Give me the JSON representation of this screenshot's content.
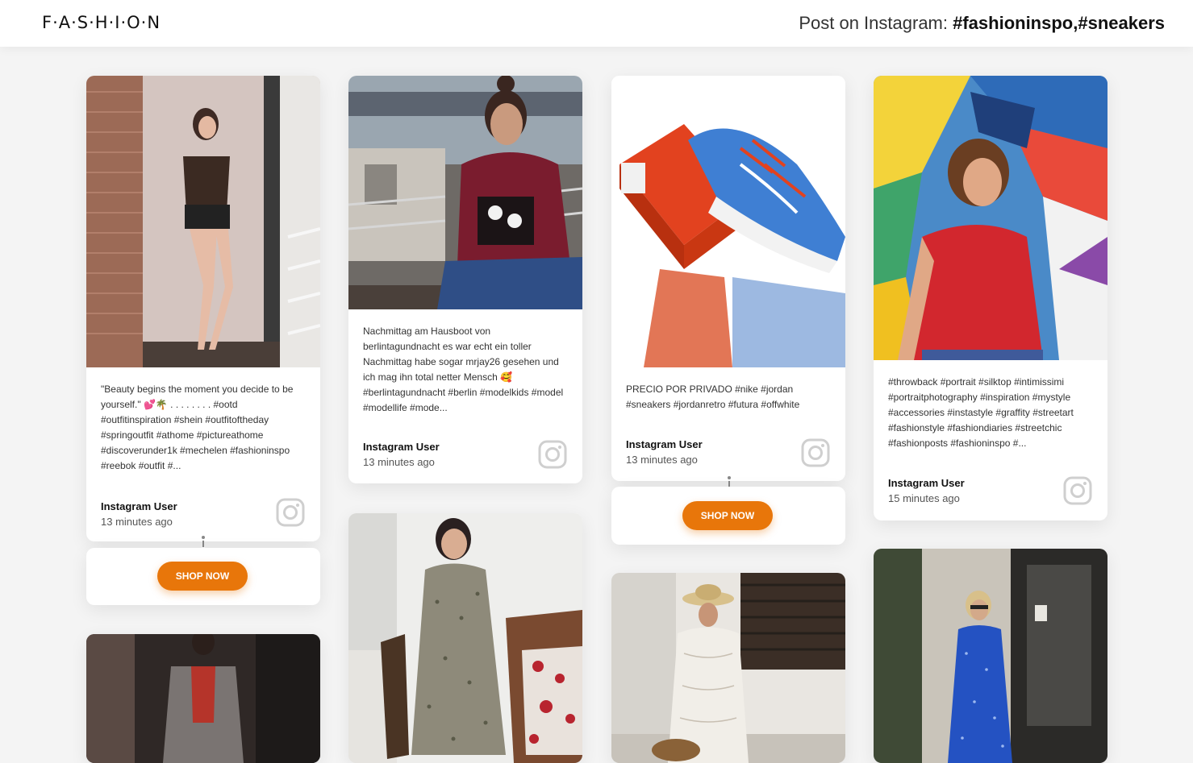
{
  "header": {
    "logo": "F·A·S·H·I·O·N",
    "prefix": "Post on Instagram: ",
    "tags": "#fashioninspo,#sneakers"
  },
  "posts": [
    {
      "caption": "\"Beauty begins the moment you decide to be yourself.\" 💕🌴 . . . . . . . . #ootd #outfitinspiration #shein #outfitoftheday #springoutfit #athome #pictureathome #discoverunder1k #mechelen #fashioninspo #reebok #outfit #...",
      "user": "Instagram User",
      "time": "13 minutes ago",
      "shop_label": "SHOP NOW"
    },
    {
      "caption": "Nachmittag am Hausboot von berlintagundnacht es war echt ein toller Nachmittag habe sogar mrjay26 gesehen und ich mag ihn total netter Mensch 🥰 #berlintagundnacht #berlin #modelkids #model #modellife #mode...",
      "user": "Instagram User",
      "time": "13 minutes ago"
    },
    {
      "caption": "PRECIO POR PRIVADO #nike #jordan #sneakers #jordanretro #futura #offwhite",
      "user": "Instagram User",
      "time": "13 minutes ago",
      "shop_label": "SHOP NOW"
    },
    {
      "caption": "#throwback #portrait #silktop #intimissimi #portraitphotography #inspiration #mystyle #accessories #instastyle #graffity #streetart #fashionstyle #fashiondiaries #streetchic #fashionposts #fashioninspo #...",
      "user": "Instagram User",
      "time": "15 minutes ago"
    }
  ],
  "colors": {
    "accent": "#e8760a",
    "background": "#f4f4f4",
    "card": "#ffffff"
  },
  "icons": {
    "post_source": "instagram-icon"
  }
}
